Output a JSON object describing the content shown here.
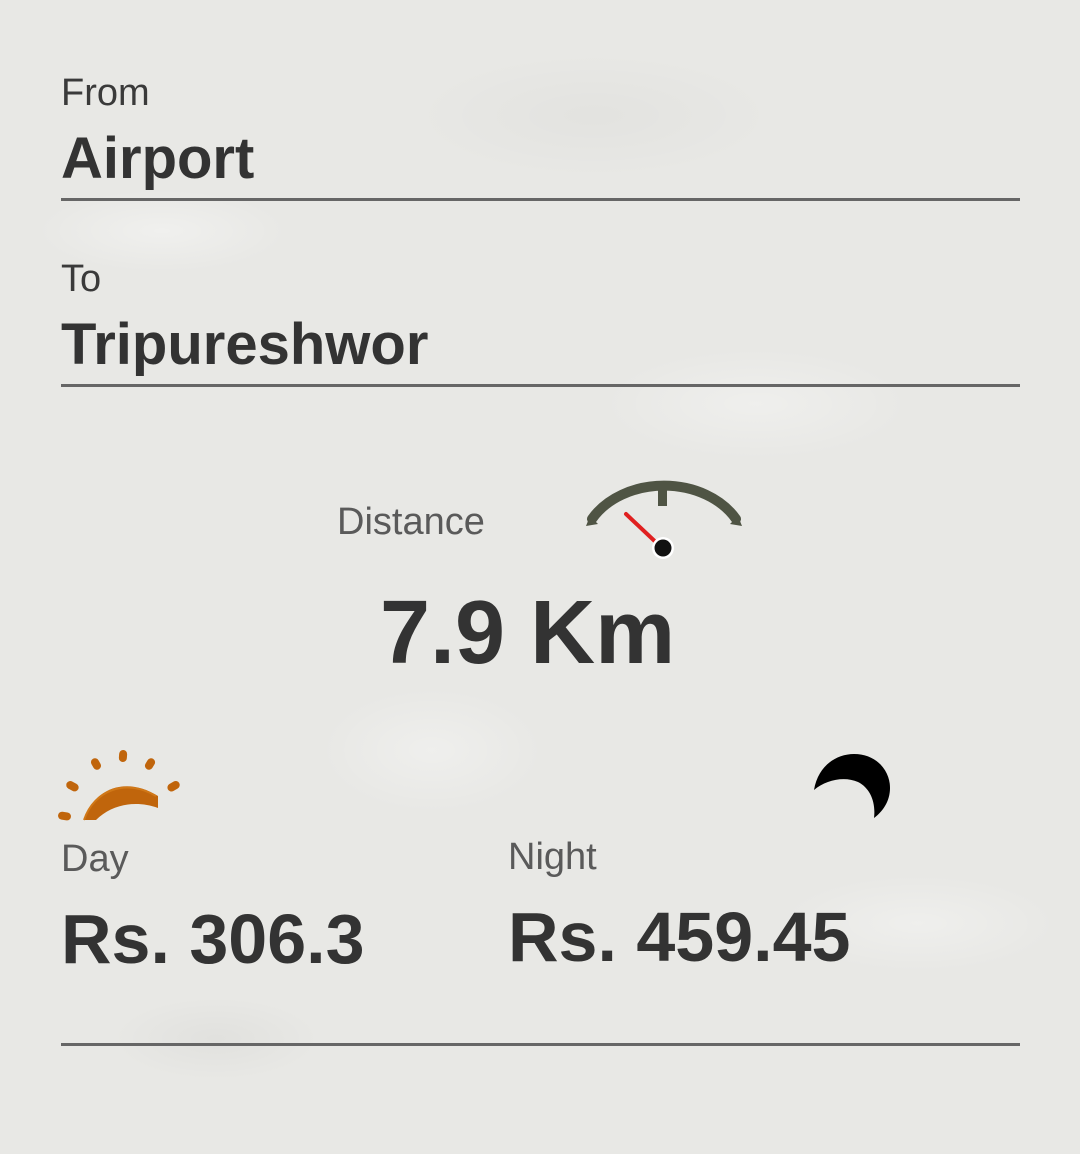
{
  "from": {
    "label": "From",
    "value": "Airport"
  },
  "to": {
    "label": "To",
    "value": "Tripureshwor"
  },
  "distance": {
    "label": "Distance",
    "value": "7.9 Km",
    "icon": "speedometer-icon"
  },
  "fares": {
    "day": {
      "label": "Day",
      "value": "Rs. 306.3",
      "icon": "sun-icon"
    },
    "night": {
      "label": "Night",
      "value": "Rs. 459.45",
      "icon": "moon-icon"
    }
  },
  "colors": {
    "text": "#333333",
    "muted_text": "#5a5a5a",
    "divider": "#666666",
    "sun": "#c0650c",
    "gauge": "#4f5444",
    "needle": "#e02020",
    "moon": "#000000"
  }
}
